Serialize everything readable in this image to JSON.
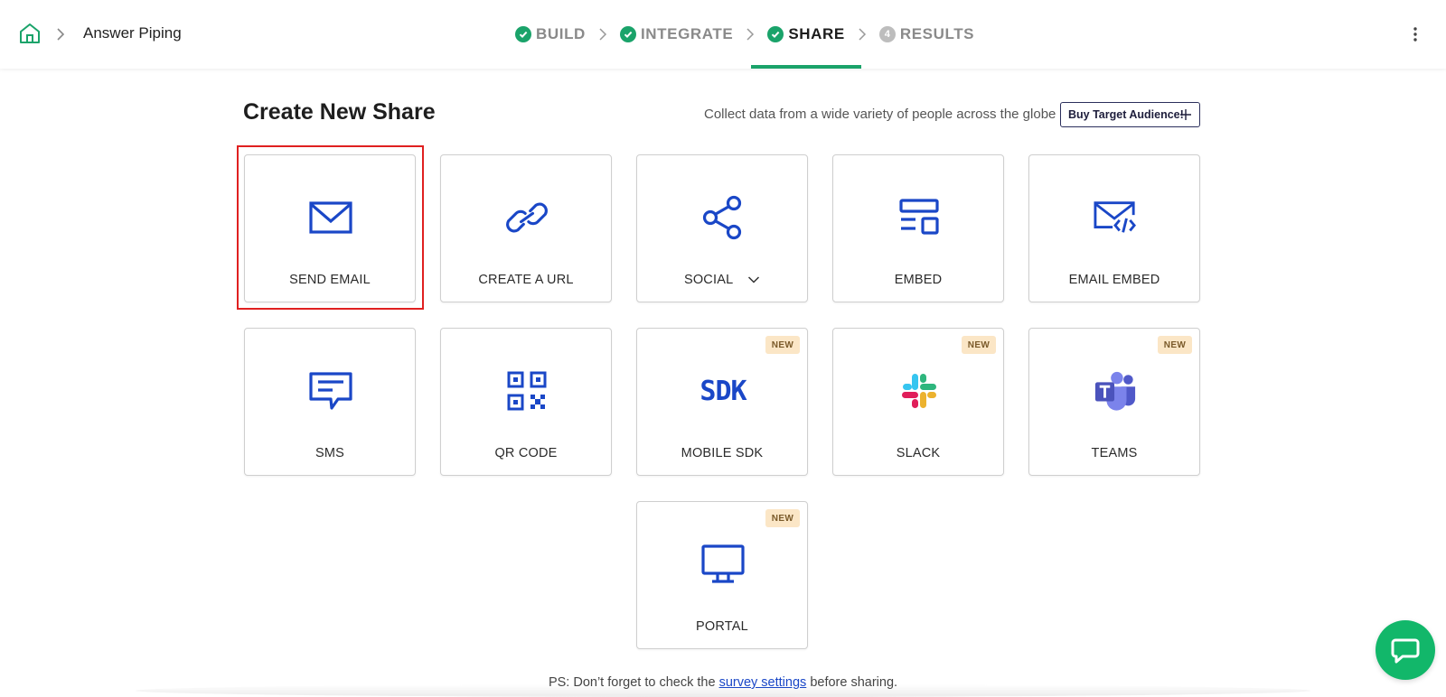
{
  "header": {
    "breadcrumb_title": "Answer Piping",
    "steps": [
      {
        "label": "BUILD",
        "state": "done"
      },
      {
        "label": "INTEGRATE",
        "state": "done"
      },
      {
        "label": "SHARE",
        "state": "active"
      },
      {
        "label": "RESULTS",
        "state": "pending",
        "number": "4"
      }
    ],
    "accent_color": "#1aa36a"
  },
  "main": {
    "title": "Create New Share",
    "collect_text": "Collect data from a wide variety of people across the globe",
    "buy_button_label": "Buy Target Audience!",
    "new_badge": "NEW",
    "cards": [
      {
        "label": "SEND EMAIL",
        "icon": "mail-icon",
        "selected": true
      },
      {
        "label": "CREATE A URL",
        "icon": "link-icon"
      },
      {
        "label": "SOCIAL",
        "icon": "share-icon",
        "dropdown": true
      },
      {
        "label": "EMBED",
        "icon": "embed-icon"
      },
      {
        "label": "EMAIL EMBED",
        "icon": "email-embed-icon"
      },
      {
        "label": "SMS",
        "icon": "message-icon"
      },
      {
        "label": "QR CODE",
        "icon": "qr-code-icon"
      },
      {
        "label": "MOBILE SDK",
        "icon": "sdk-icon",
        "sdk_text": "SDK",
        "is_new": true
      },
      {
        "label": "SLACK",
        "icon": "slack-icon",
        "is_new": true
      },
      {
        "label": "TEAMS",
        "icon": "teams-icon",
        "is_new": true
      },
      {
        "label": "PORTAL",
        "icon": "monitor-icon",
        "is_new": true
      }
    ]
  },
  "footer": {
    "prefix": "PS: Don’t forget to check the",
    "link": "survey settings",
    "suffix": "before sharing."
  },
  "colors": {
    "icon_blue": "#1a47c7",
    "highlight_red": "#e02020",
    "chat_green": "#12b76a"
  }
}
